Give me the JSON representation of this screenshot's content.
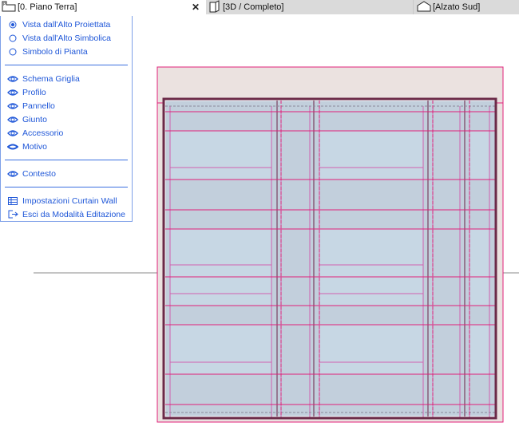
{
  "tabs": [
    {
      "label": "[0. Piano Terra]",
      "icon": "floor-plan-icon",
      "active": true
    },
    {
      "label": "[3D / Completo]",
      "icon": "3d-box-icon"
    },
    {
      "label": "[Alzato Sud]",
      "icon": "elevation-house-icon"
    }
  ],
  "menu": {
    "view_options": [
      {
        "label": "Vista dall'Alto Proiettata",
        "selected": true
      },
      {
        "label": "Vista dall'Alto Simbolica",
        "selected": false
      },
      {
        "label": "Simbolo di Pianta",
        "selected": false
      }
    ],
    "visibility": [
      {
        "label": "Schema Griglia",
        "state": "visible"
      },
      {
        "label": "Profilo",
        "state": "visible"
      },
      {
        "label": "Pannello",
        "state": "visible"
      },
      {
        "label": "Giunto",
        "state": "visible"
      },
      {
        "label": "Accessorio",
        "state": "visible"
      },
      {
        "label": "Motivo",
        "state": "hidden"
      }
    ],
    "context": {
      "label": "Contesto",
      "state": "visible"
    },
    "settings": "Impostazioni Curtain Wall",
    "exit": "Esci da Modalità Editazione"
  },
  "colors": {
    "accent": "#1f57d8",
    "magenta": "#e0207a",
    "frame": "#6b2a48",
    "panel": "#c2cfdc",
    "panel_light": "#c7d7e4",
    "bg": "#ebe2e0"
  }
}
